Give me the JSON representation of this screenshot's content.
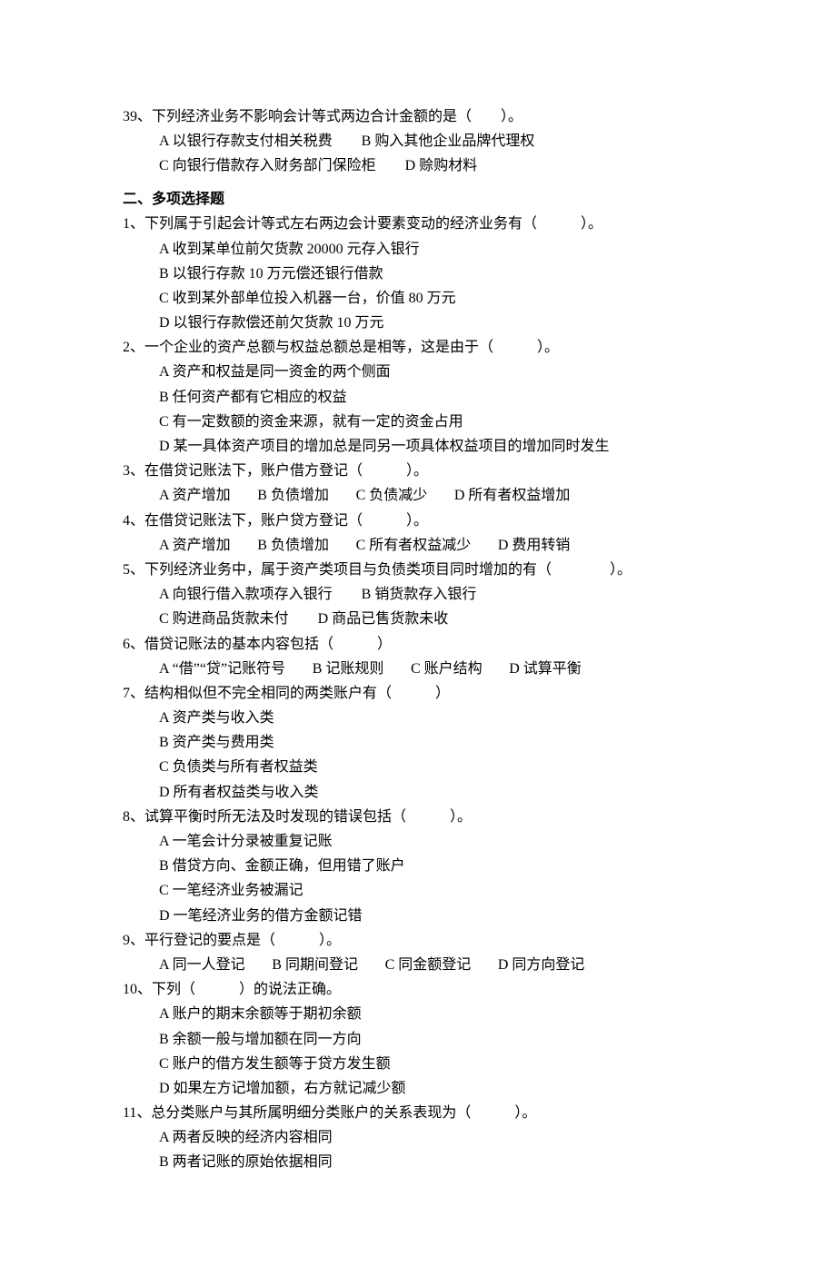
{
  "pre_questions": [
    {
      "num": "39、",
      "stem": "下列经济业务不影响会计等式两边合计金额的是（　　）。",
      "opts_block": [
        "A 以银行存款支付相关税费　　B 购入其他企业品牌代理权",
        "C 向银行借款存入财务部门保险柜　　D 赊购材料"
      ]
    }
  ],
  "section_title": "二、多项选择题",
  "questions": [
    {
      "num": "1、",
      "stem": "下列属于引起会计等式左右两边会计要素变动的经济业务有（　　　）。",
      "opts_block": [
        "A 收到某单位前欠货款 20000 元存入银行",
        "B 以银行存款 10 万元偿还银行借款",
        "C 收到某外部单位投入机器一台，价值 80 万元",
        "D 以银行存款偿还前欠货款 10 万元"
      ]
    },
    {
      "num": "2、",
      "stem": "一个企业的资产总额与权益总额总是相等，这是由于（　　　）。",
      "opts_block": [
        "A 资产和权益是同一资金的两个侧面",
        "B 任何资产都有它相应的权益",
        "C 有一定数额的资金来源，就有一定的资金占用",
        "D 某一具体资产项目的增加总是同另一项具体权益项目的增加同时发生"
      ]
    },
    {
      "num": "3、",
      "stem": "在借贷记账法下，账户借方登记（　　　）。",
      "opts_inline": [
        "A 资产增加",
        "B 负债增加",
        "C 负债减少",
        "D 所有者权益增加"
      ]
    },
    {
      "num": "4、",
      "stem": "在借贷记账法下，账户贷方登记（　　　）。",
      "opts_inline": [
        "A 资产增加",
        "B 负债增加",
        "C 所有者权益减少",
        "D 费用转销"
      ]
    },
    {
      "num": "5、",
      "stem": "下列经济业务中，属于资产类项目与负债类项目同时增加的有（　　　　）。",
      "opts_block": [
        "A 向银行借入款项存入银行　　B 销货款存入银行",
        "C 购进商品货款未付　　D 商品已售货款未收"
      ]
    },
    {
      "num": "6、",
      "stem": "借贷记账法的基本内容包括（　　　）",
      "opts_inline": [
        "A “借”“贷”记账符号",
        "B 记账规则",
        "C 账户结构",
        "D 试算平衡"
      ]
    },
    {
      "num": "7、",
      "stem": "结构相似但不完全相同的两类账户有（　　　）",
      "opts_block": [
        "A 资产类与收入类",
        "B 资产类与费用类",
        "C 负债类与所有者权益类",
        "D 所有者权益类与收入类"
      ]
    },
    {
      "num": "8、",
      "stem": "试算平衡时所无法及时发现的错误包括（　　　）。",
      "opts_block": [
        "A 一笔会计分录被重复记账",
        "B 借贷方向、金额正确，但用错了账户",
        "C 一笔经济业务被漏记",
        "D 一笔经济业务的借方金额记错"
      ]
    },
    {
      "num": "9、",
      "stem": "平行登记的要点是（　　　）。",
      "opts_inline": [
        "A 同一人登记",
        "B 同期间登记",
        "C 同金额登记",
        "D 同方向登记"
      ]
    },
    {
      "num": "10、",
      "stem": "下列（　　　）的说法正确。",
      "opts_block": [
        "A 账户的期末余额等于期初余额",
        "B 余额一般与增加额在同一方向",
        "C 账户的借方发生额等于贷方发生额",
        "D 如果左方记增加额，右方就记减少额"
      ]
    },
    {
      "num": "11、",
      "stem": "总分类账户与其所属明细分类账户的关系表现为（　　　）。",
      "opts_block": [
        "A 两者反映的经济内容相同",
        "B 两者记账的原始依据相同"
      ]
    }
  ]
}
